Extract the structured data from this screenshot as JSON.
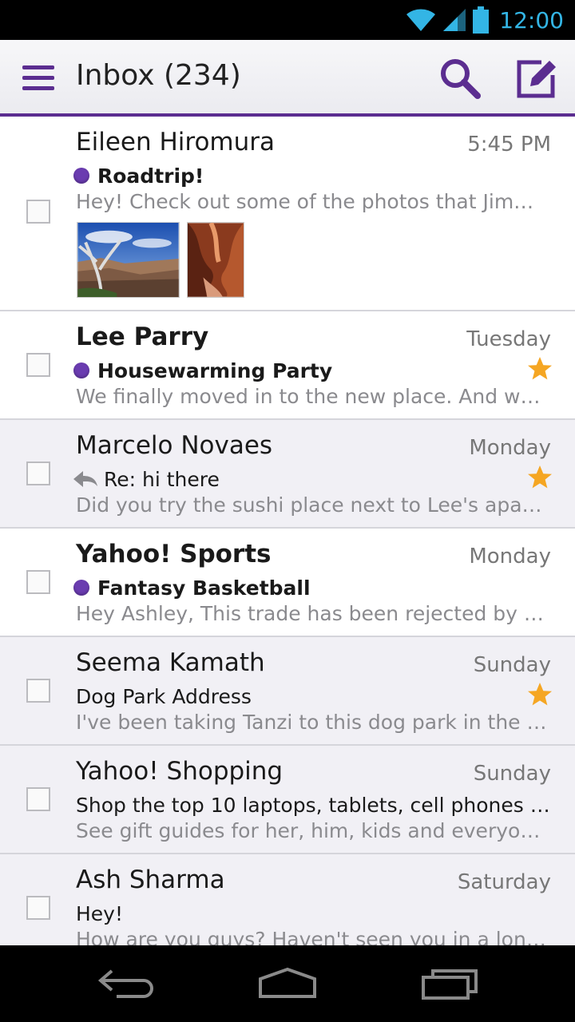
{
  "status_bar": {
    "time": "12:00",
    "icons": [
      "wifi-icon",
      "signal-icon",
      "battery-icon"
    ],
    "accent": "#33b5e5"
  },
  "action_bar": {
    "title": "Inbox (234)",
    "icons": [
      "menu-icon",
      "search-icon",
      "compose-icon"
    ],
    "accent": "#5b2d90"
  },
  "messages": [
    {
      "sender": "Eileen Hiromura",
      "date": "5:45 PM",
      "subject": "Roadtrip!",
      "snippet": "Hey! Check out some of the photos that Jimmy a...",
      "unread": true,
      "starred": false,
      "has_dot": true,
      "replied": false,
      "attachments": [
        "canyon-photo",
        "slot-canyon-photo"
      ]
    },
    {
      "sender": "Lee Parry",
      "date": "Tuesday",
      "subject": "Housewarming Party",
      "snippet": "We finally moved in to the new place. And we'd lo...",
      "unread": true,
      "starred": true,
      "has_dot": true,
      "replied": false
    },
    {
      "sender": "Marcelo Novaes",
      "date": "Monday",
      "subject": "Re: hi there",
      "snippet": "Did you try the sushi place next to Lee's apartme...",
      "unread": false,
      "starred": true,
      "has_dot": false,
      "replied": true
    },
    {
      "sender": "Yahoo! Sports",
      "date": "Monday",
      "subject": "Fantasy Basketball",
      "snippet": "Hey Ashley, This trade has been rejected by the l...",
      "unread": true,
      "starred": false,
      "has_dot": true,
      "replied": false
    },
    {
      "sender": "Seema Kamath",
      "date": "Sunday",
      "subject": "Dog Park Address",
      "snippet": "I've been taking Tanzi to this dog park in the neig...",
      "unread": false,
      "starred": true,
      "has_dot": false,
      "replied": false
    },
    {
      "sender": "Yahoo! Shopping",
      "date": "Sunday",
      "subject": "Shop the top 10 laptops, tablets, cell phones & m...",
      "snippet": "See gift guides for her, him, kids and everyone els...",
      "unread": false,
      "starred": false,
      "has_dot": false,
      "replied": false
    },
    {
      "sender": "Ash Sharma",
      "date": "Saturday",
      "subject": "Hey!",
      "snippet": "How are you guys? Haven't seen you in a long tim...",
      "unread": false,
      "starred": false,
      "has_dot": false,
      "replied": false
    }
  ],
  "colors": {
    "unread_dot": "#6a3cb0",
    "star": "#f5a623",
    "read_row_bg": "#f1f0f5"
  },
  "nav_bar": {
    "icons": [
      "back-icon",
      "home-icon",
      "recent-apps-icon"
    ]
  }
}
